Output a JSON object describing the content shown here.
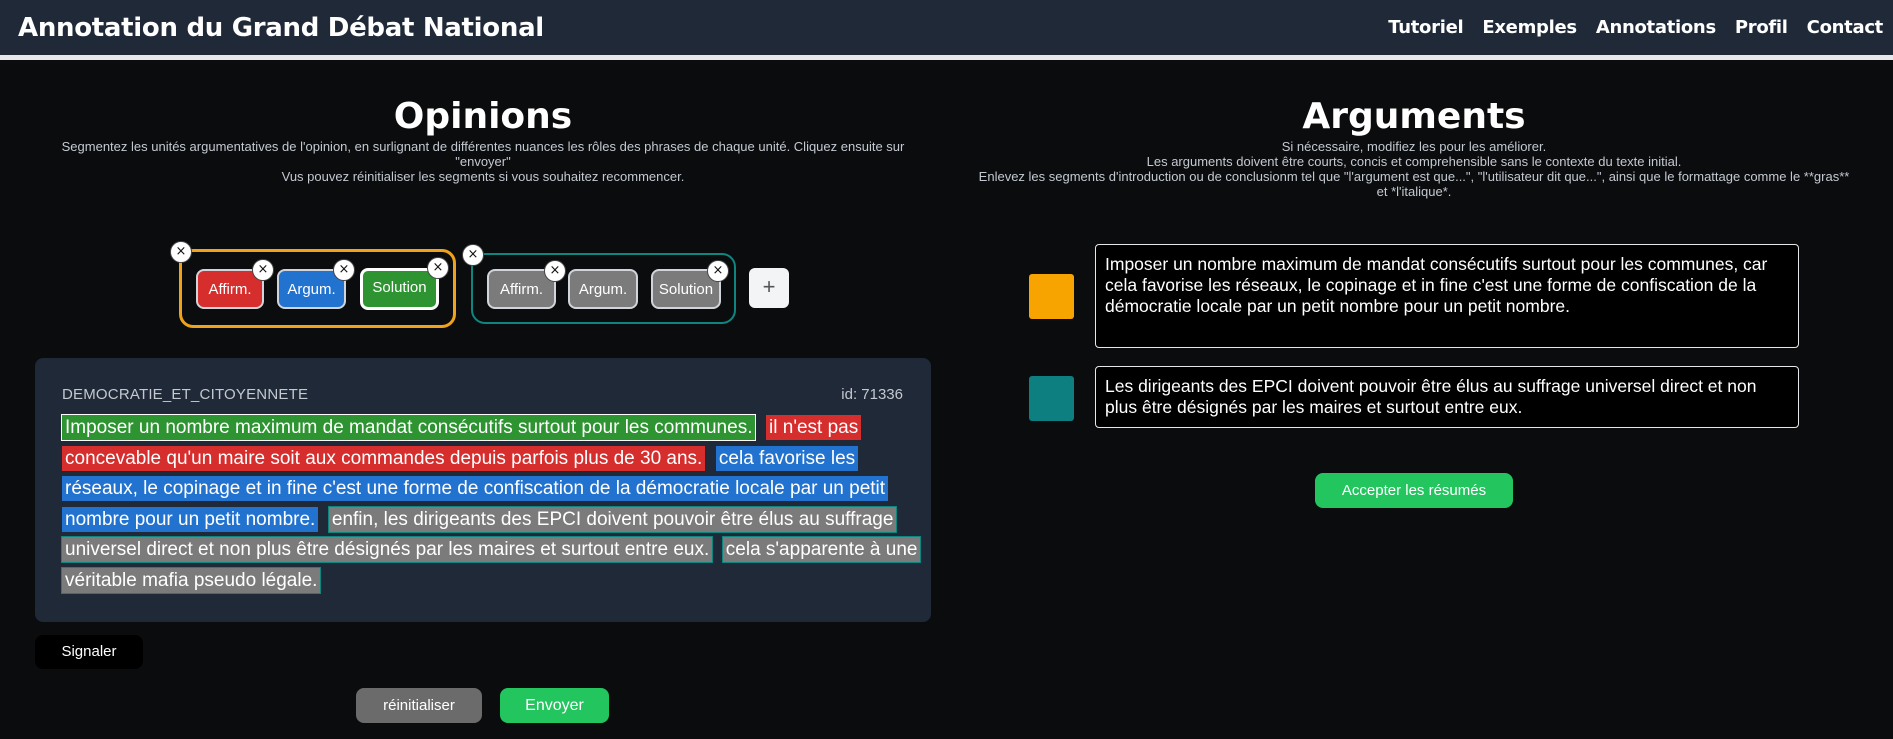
{
  "header": {
    "title": "Annotation du Grand Débat National",
    "nav": [
      "Tutoriel",
      "Exemples",
      "Annotations",
      "Profil",
      "Contact"
    ]
  },
  "opinions": {
    "title": "Opinions",
    "desc_line1": "Segmentez les unités argumentatives de l'opinion, en surlignant de différentes nuances les rôles des phrases de chaque unité. Cliquez ensuite sur",
    "desc_line2": "\"envoyer\"",
    "desc_line3": "Vus pouvez réinitialiser les segments si vous souhaitez recommencer.",
    "remove_symbol": "×",
    "add_symbol": "+",
    "units": [
      {
        "border_color": "#f0a21a",
        "roles": [
          {
            "label": "Affirm.",
            "color": "#d62d2d"
          },
          {
            "label": "Argum.",
            "color": "#2272d0"
          },
          {
            "label": "Solution",
            "color": "#2e9331"
          }
        ]
      },
      {
        "border_color": "#0f8580",
        "roles": [
          {
            "label": "Affirm.",
            "color": "#7b7b7b"
          },
          {
            "label": "Argum.",
            "color": "#7b7b7b"
          },
          {
            "label": "Solution",
            "color": "#7b7b7b"
          }
        ]
      }
    ],
    "card": {
      "category": "DEMOCRATIE_ET_CITOYENNETE",
      "id": "id: 71336",
      "segments": [
        {
          "text": "Imposer un nombre maximum de mandat consécutifs surtout pour les communes.",
          "role": "green"
        },
        {
          "text": "il n'est pas concevable qu'un maire soit aux commandes depuis parfois plus de 30 ans.",
          "role": "red"
        },
        {
          "text": "cela favorise les réseaux, le copinage et in fine c'est une forme de confiscation de la démocratie locale par un petit nombre pour un petit nombre.",
          "role": "blue"
        },
        {
          "text": "enfin, les dirigeants des EPCI doivent pouvoir être élus au suffrage universel direct et non plus être désignés par les maires et surtout entre eux.",
          "role": "grey"
        },
        {
          "text": "cela s'apparente à une véritable mafia pseudo légale.",
          "role": "grey"
        }
      ]
    },
    "buttons": {
      "signal": "Signaler",
      "reset": "réinitialiser",
      "send": "Envoyer"
    }
  },
  "arguments": {
    "title": "Arguments",
    "desc_line1": "Si nécessaire, modifiez les pour les améliorer.",
    "desc_line2": "Les arguments doivent être courts, concis et comprehensible sans le contexte du texte initial.",
    "desc_line3": "Enlevez les segments d'introduction ou de conclusionm tel que \"l'argument est que...\", \"l'utilisateur dit que...\", ainsi que le formattage comme le **gras**",
    "desc_line4": "et *l'italique*.",
    "items": [
      {
        "color": "#f7a400",
        "text": "Imposer un nombre maximum de mandat consécutifs surtout pour les communes, car cela favorise les réseaux, le copinage et in fine c'est une forme de confiscation de la démocratie locale par un petit nombre pour un petit nombre."
      },
      {
        "color": "#0d7f80",
        "text": "Les dirigeants des EPCI doivent pouvoir être élus au suffrage universel direct et non plus être désignés par les maires et surtout entre eux."
      }
    ],
    "accept": "Accepter les résumés"
  }
}
